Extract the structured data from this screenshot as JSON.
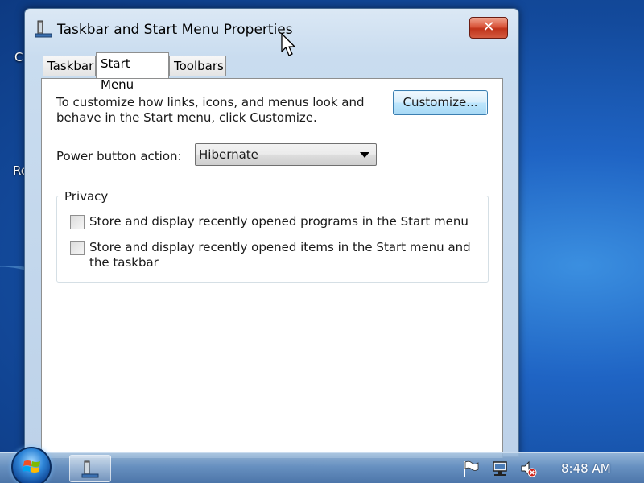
{
  "desktop": {
    "fragment_top": "C",
    "fragment_mid": "Re"
  },
  "window": {
    "title": "Taskbar and Start Menu Properties",
    "close_label": "✕",
    "tabs": [
      {
        "label": "Taskbar",
        "active": false
      },
      {
        "label": "Start Menu",
        "active": true
      },
      {
        "label": "Toolbars",
        "active": false
      }
    ],
    "description": "To customize how links, icons, and menus look and behave in the Start menu, click Customize.",
    "customize_label": "Customize...",
    "power_label": "Power button action:",
    "power_value": "Hibernate",
    "privacy": {
      "legend": "Privacy",
      "options": [
        {
          "label": "Store and display recently opened programs in the Start menu",
          "checked": false
        },
        {
          "label": "Store and display recently opened items in the Start menu and the taskbar",
          "checked": false
        }
      ]
    }
  },
  "taskbar": {
    "clock": "8:48 AM",
    "tray_icons": [
      "flag-icon",
      "network-icon",
      "speaker-muted-icon"
    ]
  }
}
